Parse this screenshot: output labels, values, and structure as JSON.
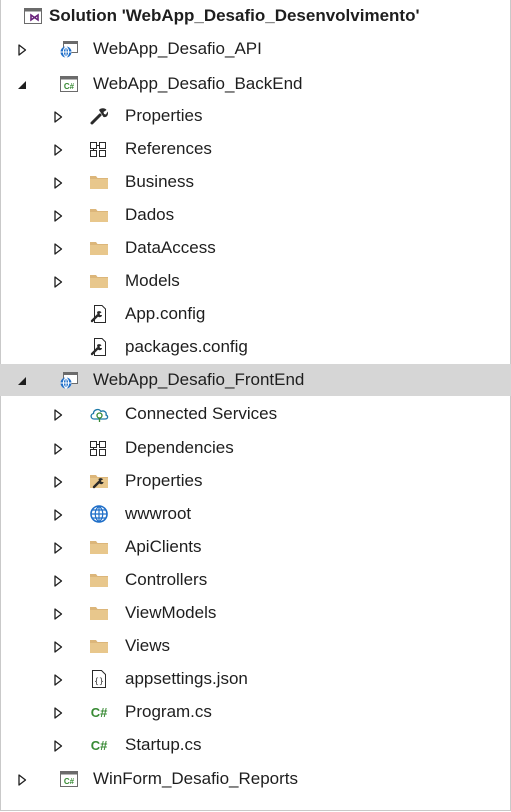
{
  "solution_explorer": {
    "items": [
      {
        "label": "Solution 'WebApp_Desafio_Desenvolvimento'",
        "icon": "solution-icon",
        "arrow": "none",
        "bold": true
      },
      {
        "label": "WebApp_Desafio_API",
        "icon": "web-project-icon",
        "arrow": "collapsed"
      },
      {
        "label": "WebApp_Desafio_BackEnd",
        "icon": "csharp-project-icon",
        "arrow": "expanded"
      },
      {
        "label": "Properties",
        "icon": "wrench-icon",
        "arrow": "collapsed"
      },
      {
        "label": "References",
        "icon": "references-icon",
        "arrow": "collapsed"
      },
      {
        "label": "Business",
        "icon": "folder-icon",
        "arrow": "collapsed"
      },
      {
        "label": "Dados",
        "icon": "folder-icon",
        "arrow": "collapsed"
      },
      {
        "label": "DataAccess",
        "icon": "folder-icon",
        "arrow": "collapsed"
      },
      {
        "label": "Models",
        "icon": "folder-icon",
        "arrow": "collapsed"
      },
      {
        "label": "App.config",
        "icon": "config-file-icon",
        "arrow": "none"
      },
      {
        "label": "packages.config",
        "icon": "config-file-icon",
        "arrow": "none"
      },
      {
        "label": "WebApp_Desafio_FrontEnd",
        "icon": "web-project-icon",
        "arrow": "expanded",
        "selected": true
      },
      {
        "label": "Connected Services",
        "icon": "connected-services-icon",
        "arrow": "collapsed"
      },
      {
        "label": "Dependencies",
        "icon": "dependencies-icon",
        "arrow": "collapsed"
      },
      {
        "label": "Properties",
        "icon": "properties-folder-icon",
        "arrow": "collapsed"
      },
      {
        "label": "wwwroot",
        "icon": "globe-icon",
        "arrow": "collapsed"
      },
      {
        "label": "ApiClients",
        "icon": "folder-icon",
        "arrow": "collapsed"
      },
      {
        "label": "Controllers",
        "icon": "folder-icon",
        "arrow": "collapsed"
      },
      {
        "label": "ViewModels",
        "icon": "folder-icon",
        "arrow": "collapsed"
      },
      {
        "label": "Views",
        "icon": "folder-icon",
        "arrow": "collapsed"
      },
      {
        "label": "appsettings.json",
        "icon": "json-file-icon",
        "arrow": "collapsed"
      },
      {
        "label": "Program.cs",
        "icon": "csharp-file-icon",
        "arrow": "collapsed"
      },
      {
        "label": "Startup.cs",
        "icon": "csharp-file-icon",
        "arrow": "collapsed"
      },
      {
        "label": "WinForm_Desafio_Reports",
        "icon": "csharp-project-icon",
        "arrow": "collapsed"
      }
    ]
  },
  "colors": {
    "selected_row": "#d6d6d6",
    "folder": "#dcb67a",
    "csharp_green": "#388a34",
    "web_blue": "#1e6ec8",
    "arrow": "#1e1e1e"
  }
}
